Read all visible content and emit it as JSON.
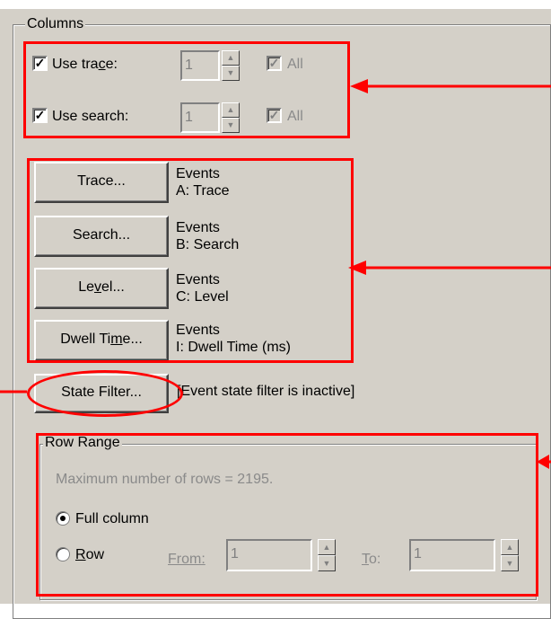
{
  "columns_group": {
    "title": "Columns",
    "use_trace": {
      "label_pre": "Use tra",
      "label_u": "c",
      "label_post": "e:",
      "checked_mark": "✓",
      "value": "1",
      "all_label": "All",
      "all_mark": "✓"
    },
    "use_search": {
      "label": "Use search:",
      "checked_mark": "✓",
      "value": "1",
      "all_label": "All",
      "all_mark": "✓"
    },
    "buttons": [
      {
        "label": "Trace...",
        "event_line1": "Events",
        "event_line2": "A: Trace"
      },
      {
        "label_pre": "Search...",
        "event_line1": "Events",
        "event_line2": "B: Search"
      },
      {
        "label_pre": "Le",
        "label_u": "v",
        "label_post": "el...",
        "event_line1": "Events",
        "event_line2": "C: Level"
      },
      {
        "label_pre": "Dwell Ti",
        "label_u": "m",
        "label_post": "e...",
        "event_line1": "Events",
        "event_line2": "I: Dwell Time (ms)"
      }
    ],
    "state_filter": {
      "label": "State Filter...",
      "status": "[Event state filter is inactive]"
    }
  },
  "row_range": {
    "title": "Row Range",
    "max_rows_text": "Maximum number of rows = 2195.",
    "full_column_label": "Full column",
    "row_label_u": "R",
    "row_label_post": "ow",
    "from_label": "From:",
    "from_value": "1",
    "to_label_u": "T",
    "to_label_post": "o:",
    "to_value": "1"
  },
  "colors": {
    "annotation": "#ff0000",
    "dialog_bg": "#d4d0c8"
  }
}
